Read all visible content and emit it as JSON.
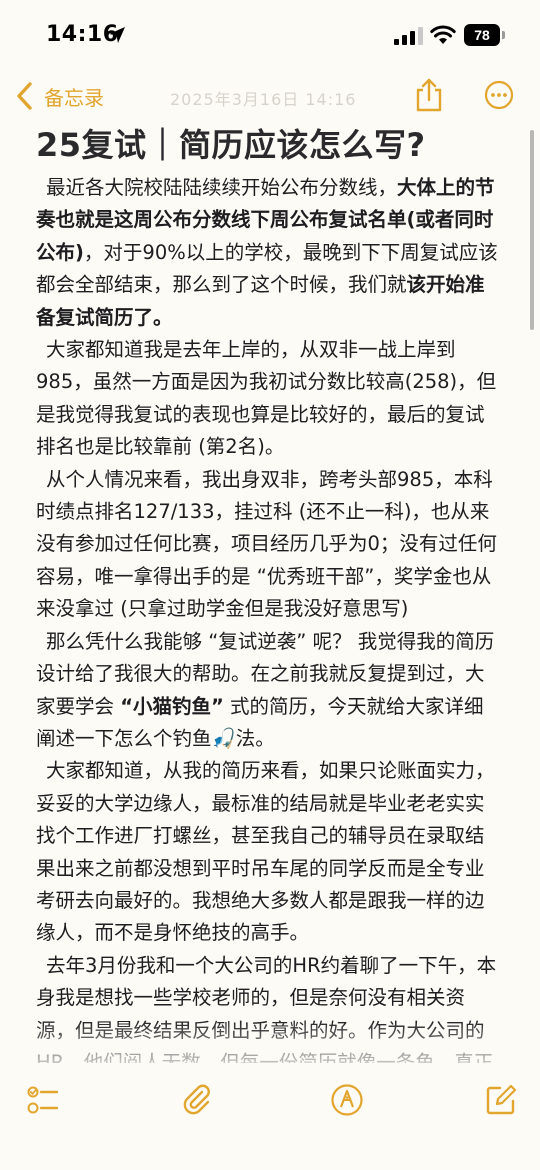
{
  "status_bar": {
    "time": "14:16",
    "battery": "78"
  },
  "nav": {
    "back_label": "备忘录",
    "date": "2025年3月16日 14:16",
    "icons": [
      "chevron-left-icon",
      "share-icon",
      "ellipsis-icon"
    ]
  },
  "note": {
    "title": "25复试｜简历应该怎么写?",
    "paragraphs": [
      [
        {
          "t": "最近各大院校陆陆续续开始公布分数线，",
          "b": false
        },
        {
          "t": "大体上的节奏也就是这周公布分数线下周公布复试名单(或者同时公布)",
          "b": true
        },
        {
          "t": "，对于90%以上的学校，最晚到下下周复试应该都会全部结束，那么到了这个时候，我们就",
          "b": false
        },
        {
          "t": "该开始准备复试简历了。",
          "b": true
        }
      ],
      [
        {
          "t": "大家都知道我是去年上岸的，从双非一战上岸到985，虽然一方面是因为我初试分数比较高(258)，但是我觉得我复试的表现也算是比较好的，最后的复试排名也是比较靠前 (第2名)。",
          "b": false
        }
      ],
      [
        {
          "t": "从个人情况来看，我出身双非，跨考头部985，本科时绩点排名127/133，挂过科 (还不止一科)，也从来没有参加过任何比赛，项目经历几乎为0；没有过任何容易，唯一拿得出手的是 “优秀班干部”，奖学金也从来没拿过 (只拿过助学金但是我没好意思写)",
          "b": false
        }
      ],
      [
        {
          "t": "那么凭什么我能够 “复试逆袭” 呢？ 我觉得我的简历设计给了我很大的帮助。在之前我就反复提到过，大家要学会 ",
          "b": false
        },
        {
          "t": "“小猫钓鱼”",
          "b": true
        },
        {
          "t": " 式的简历，今天就给大家详细阐述一下怎么个钓鱼🎣法。",
          "b": false
        }
      ],
      [
        {
          "t": "大家都知道，从我的简历来看，如果只论账面实力，妥妥的大学边缘人，最标准的结局就是毕业老老实实找个工作进厂打螺丝，甚至我自己的辅导员在录取结果出来之前都没想到平时吊车尾的同学反而是全专业考研去向最好的。我想绝大多数人都是跟我一样的边缘人，而不是身怀绝技的高手。",
          "b": false
        }
      ],
      [
        {
          "t": "去年3月份我和一个大公司的HR约着聊了一下午，本身我是想找一些学校老师的，但是奈何没有相关资源，但是最终结果反倒出乎意料的好。作为大公司的HR，他们阅人无数，但每一份简历就像一条鱼，真正好的简历都很少让他们感到惊艳，我就深有体会。",
          "b": false
        }
      ]
    ]
  },
  "toolbar": {
    "icons": [
      "checklist-icon",
      "paperclip-icon",
      "markup-pen-icon",
      "compose-icon"
    ]
  },
  "colors": {
    "accent": "#e2a62f",
    "background": "#fdfbf6",
    "text": "#1e1e20"
  }
}
